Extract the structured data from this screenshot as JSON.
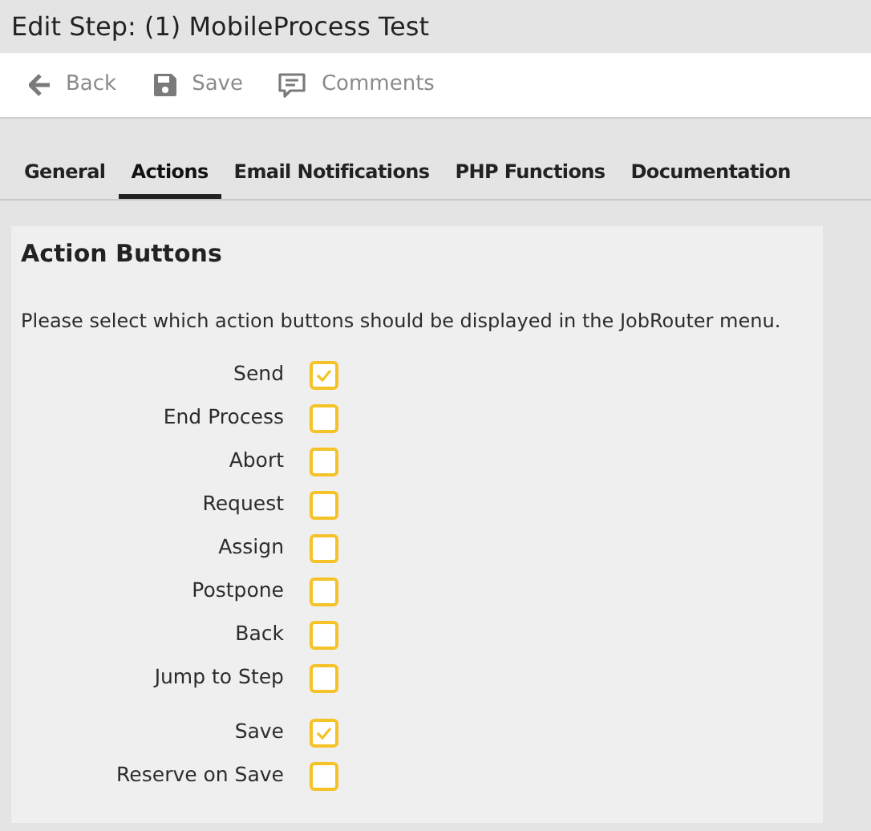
{
  "window": {
    "title": "Edit Step: (1) MobileProcess Test"
  },
  "toolbar": [
    {
      "kind": "back",
      "label": "Back"
    },
    {
      "kind": "save",
      "label": "Save"
    },
    {
      "kind": "comments",
      "label": "Comments"
    }
  ],
  "tabs": [
    {
      "label": "General",
      "selected": false
    },
    {
      "label": "Actions",
      "selected": true
    },
    {
      "label": "Email Notifications",
      "selected": false
    },
    {
      "label": "PHP Functions",
      "selected": false
    },
    {
      "label": "Documentation",
      "selected": false
    }
  ],
  "panel": {
    "title": "Action Buttons",
    "description": "Please select which action buttons should be displayed in the JobRouter menu.",
    "groups": [
      [
        {
          "label": "Send",
          "checked": true
        },
        {
          "label": "End Process",
          "checked": false
        },
        {
          "label": "Abort",
          "checked": false
        },
        {
          "label": "Request",
          "checked": false
        },
        {
          "label": "Assign",
          "checked": false
        },
        {
          "label": "Postpone",
          "checked": false
        },
        {
          "label": "Back",
          "checked": false
        },
        {
          "label": "Jump to Step",
          "checked": false
        }
      ],
      [
        {
          "label": "Save",
          "checked": true
        },
        {
          "label": "Reserve on Save",
          "checked": false
        }
      ]
    ]
  }
}
